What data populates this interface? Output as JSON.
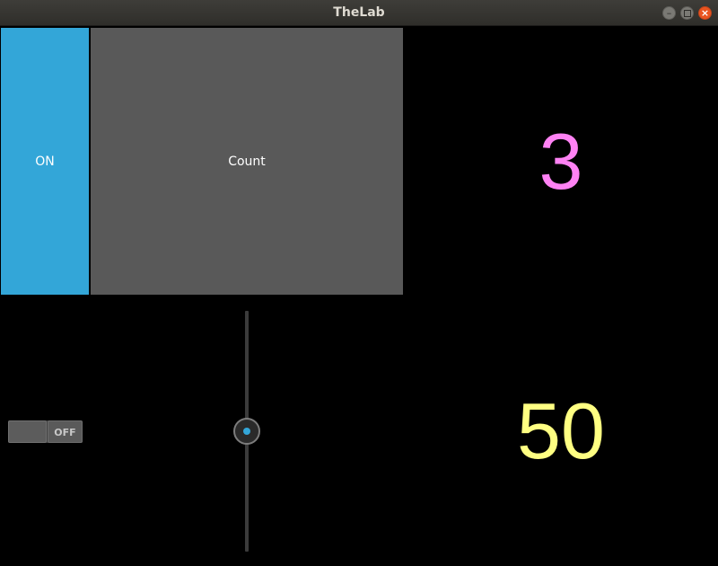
{
  "window": {
    "title": "TheLab",
    "controls": {
      "minimize_icon": "minimize-icon",
      "maximize_icon": "maximize-icon",
      "close_icon": "close-icon"
    },
    "close_color": "#e95420"
  },
  "top_row": {
    "toggle_button": {
      "label": "ON",
      "state": "on",
      "color": "#33a6d8"
    },
    "count_button": {
      "label": "Count",
      "color": "#595959"
    },
    "count_value": {
      "text": "3",
      "color": "#ff82f4"
    }
  },
  "bottom_row": {
    "switch": {
      "state_text": "OFF",
      "active": false
    },
    "slider": {
      "value": 50,
      "min": 0,
      "max": 100,
      "orientation": "vertical",
      "accent": "#33a6d8"
    },
    "slider_value": {
      "text": "50",
      "color": "#ffff82"
    }
  }
}
